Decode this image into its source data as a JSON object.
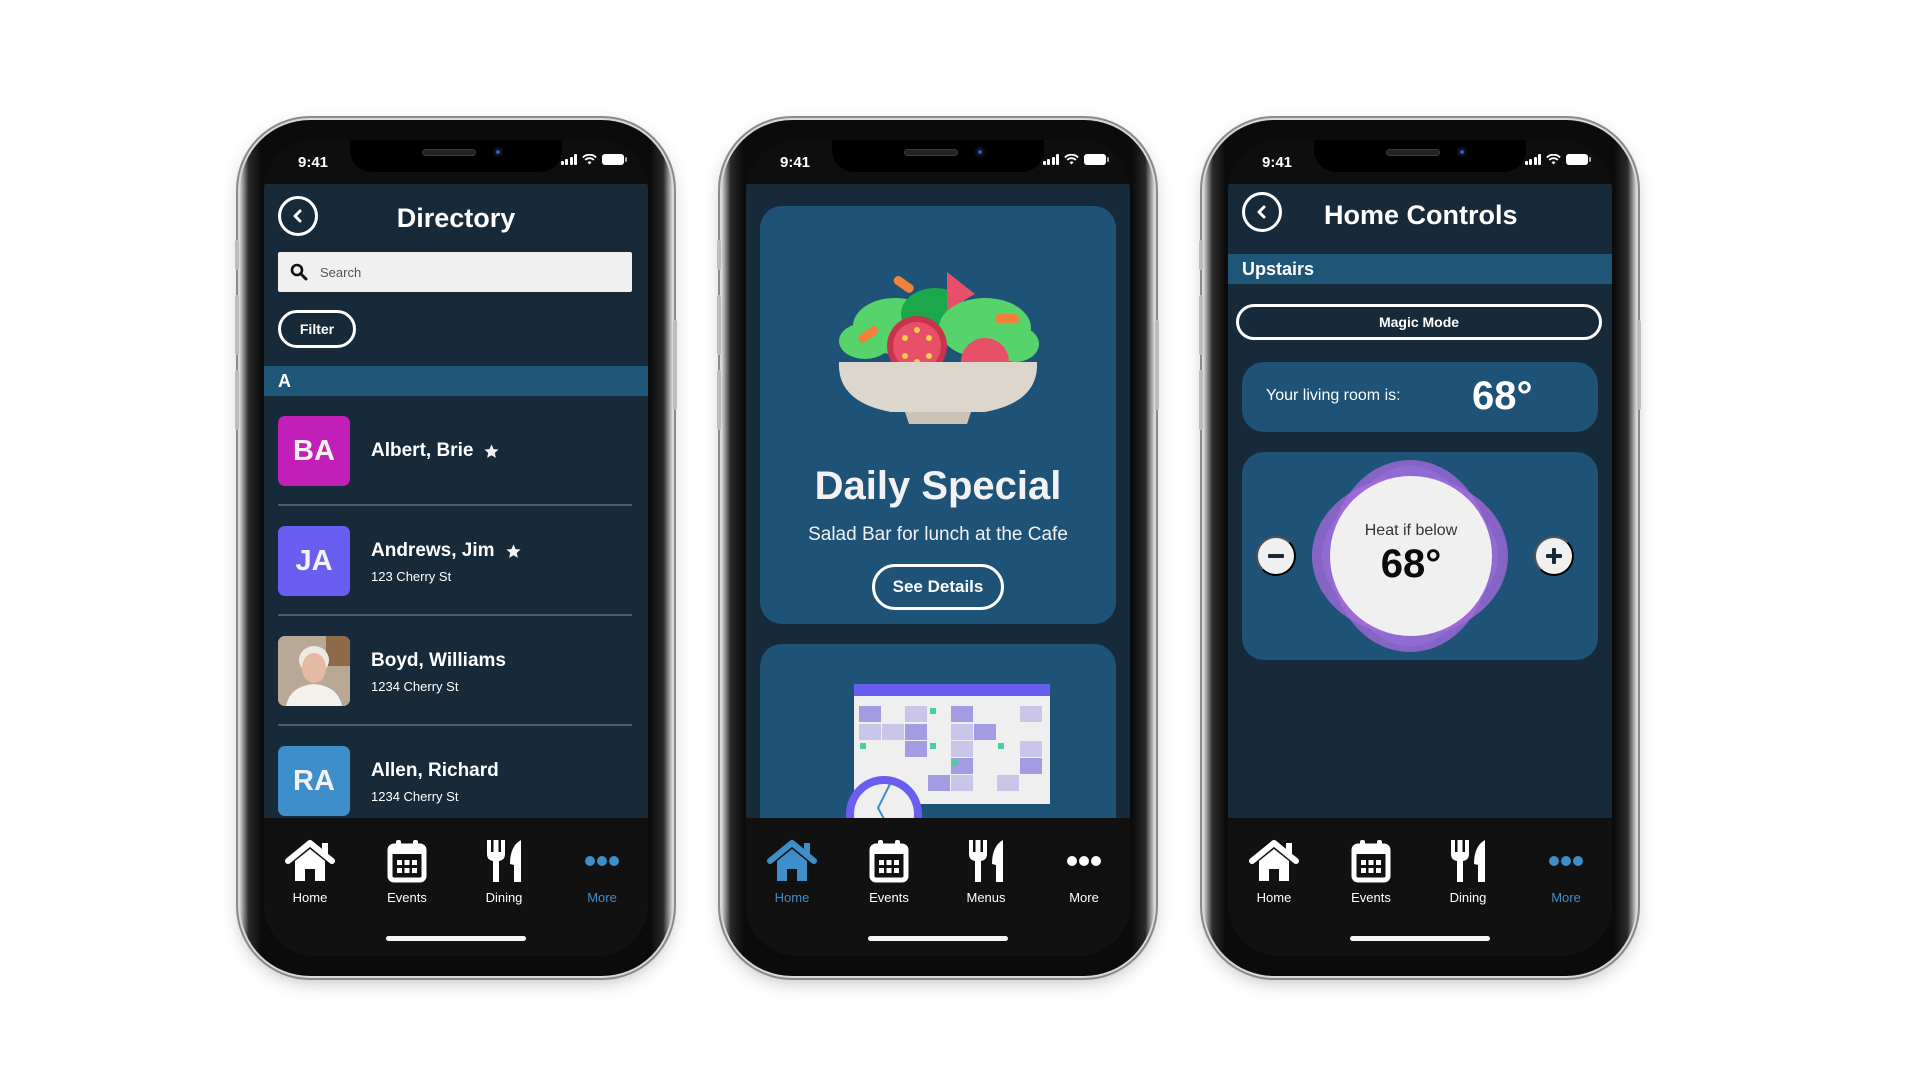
{
  "status_bar": {
    "time": "9:41"
  },
  "colors": {
    "screen_bg": "#172a3a",
    "card_bg": "#1e5277",
    "section_header_bg": "#1f5577",
    "tab_bar_bg": "#111111",
    "active_tab": "#3d8ec9",
    "thermostat_ring": "#a86be0"
  },
  "directory": {
    "title": "Directory",
    "back_icon": "chevron-left-circle-icon",
    "search": {
      "placeholder": "Search",
      "value": ""
    },
    "filter_label": "Filter",
    "section_letter": "A",
    "contacts": [
      {
        "initials": "BA",
        "name": "Albert, Brie",
        "address": "",
        "favorite": true,
        "avatar_color": "#c21fb8"
      },
      {
        "initials": "JA",
        "name": "Andrews, Jim",
        "address": "123 Cherry St",
        "favorite": true,
        "avatar_color": "#6a5ef0"
      },
      {
        "initials": "",
        "name": "Boyd, Williams",
        "address": "1234 Cherry St",
        "favorite": false,
        "avatar_type": "photo"
      },
      {
        "initials": "RA",
        "name": "Allen, Richard",
        "address": "1234 Cherry St",
        "favorite": false,
        "avatar_color": "#3d8ec9"
      }
    ],
    "tabs": [
      {
        "label": "Home",
        "icon": "home-icon",
        "active": false
      },
      {
        "label": "Events",
        "icon": "calendar-icon",
        "active": false
      },
      {
        "label": "Dining",
        "icon": "fork-knife-icon",
        "active": false
      },
      {
        "label": "More",
        "icon": "more-dots-icon",
        "active": true
      }
    ]
  },
  "home": {
    "special_card": {
      "image": "salad-bowl-illustration",
      "title": "Daily Special",
      "subtitle": "Salad Bar for lunch at the Cafe",
      "button_label": "See Details"
    },
    "events_card": {
      "image": "calendar-clock-illustration"
    },
    "tabs": [
      {
        "label": "Home",
        "icon": "home-icon",
        "active": true
      },
      {
        "label": "Events",
        "icon": "calendar-icon",
        "active": false
      },
      {
        "label": "Menus",
        "icon": "fork-knife-icon",
        "active": false
      },
      {
        "label": "More",
        "icon": "more-dots-icon",
        "active": false
      }
    ]
  },
  "controls": {
    "title": "Home Controls",
    "back_icon": "chevron-left-circle-icon",
    "section": "Upstairs",
    "magic_mode_label": "Magic Mode",
    "room_label": "Your living room is:",
    "room_temp": "68°",
    "thermostat": {
      "label": "Heat if below",
      "setpoint": "68°",
      "decrease_icon": "minus-icon",
      "increase_icon": "plus-icon"
    },
    "tabs": [
      {
        "label": "Home",
        "icon": "home-icon",
        "active": false
      },
      {
        "label": "Events",
        "icon": "calendar-icon",
        "active": false
      },
      {
        "label": "Dining",
        "icon": "fork-knife-icon",
        "active": false
      },
      {
        "label": "More",
        "icon": "more-dots-icon",
        "active": true
      }
    ]
  }
}
